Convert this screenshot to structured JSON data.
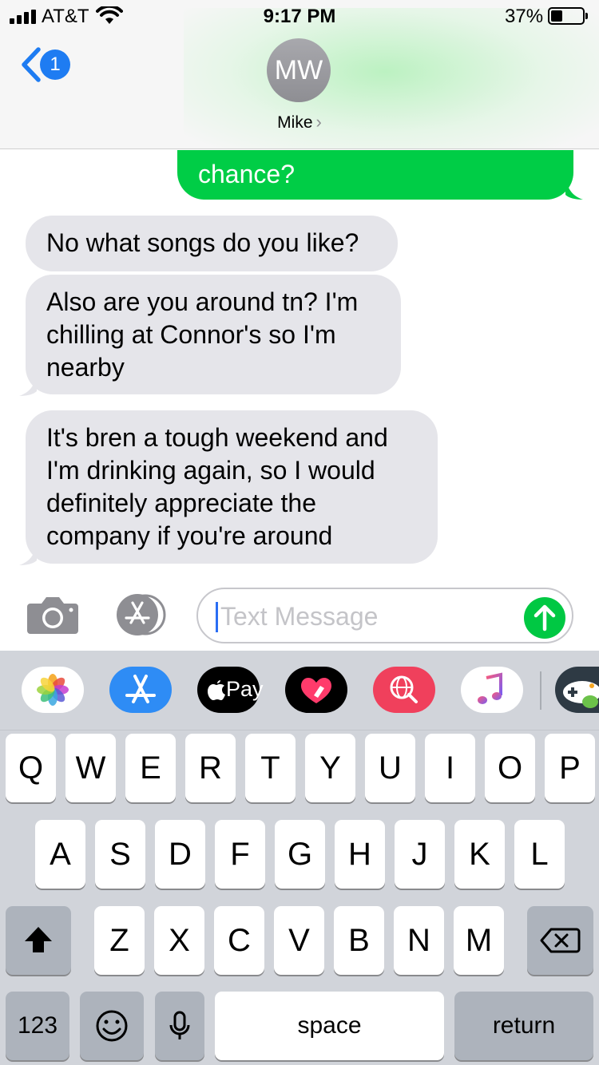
{
  "status_bar": {
    "carrier": "AT&T",
    "time": "9:17 PM",
    "battery_percent": "37%",
    "battery_level": 0.37
  },
  "header": {
    "back_badge": "1",
    "avatar_initials": "MW",
    "contact_name": "Mike",
    "contact_chevron": "›"
  },
  "messages": [
    {
      "from": "me",
      "text": "chance?"
    },
    {
      "from": "them",
      "text": "No what songs do you like?"
    },
    {
      "from": "them",
      "lines": [
        "Also are you around tn? I'm",
        "chilling at Connor's so I'm",
        "nearby"
      ]
    },
    {
      "from": "them",
      "lines": [
        "It's bren a tough weekend and",
        "I'm drinking again, so I would",
        "definitely appreciate the",
        "company if you're around"
      ]
    }
  ],
  "input": {
    "placeholder": "Text Message"
  },
  "app_strip": [
    {
      "name": "photos-icon",
      "bg": "#ffffff"
    },
    {
      "name": "app-store-icon",
      "bg": "#2e8cf5"
    },
    {
      "name": "apple-pay-icon",
      "bg": "#000000",
      "label": "Pay"
    },
    {
      "name": "digital-touch-icon",
      "bg": "#000000"
    },
    {
      "name": "images-search-icon",
      "bg": "#f0405c"
    },
    {
      "name": "music-icon",
      "bg": "#ffffff"
    },
    {
      "name": "game-app-icon",
      "bg": "#2e3a44"
    }
  ],
  "keyboard": {
    "row1": [
      "Q",
      "W",
      "E",
      "R",
      "T",
      "Y",
      "U",
      "I",
      "O",
      "P"
    ],
    "row2": [
      "A",
      "S",
      "D",
      "F",
      "G",
      "H",
      "J",
      "K",
      "L"
    ],
    "row3": [
      "Z",
      "X",
      "C",
      "V",
      "B",
      "N",
      "M"
    ],
    "numbers_key": "123",
    "space_key": "space",
    "return_key": "return"
  },
  "colors": {
    "sent_bubble": "#00cd46",
    "received_bubble": "#e5e5ea",
    "accent_blue": "#1e7cf2",
    "send_button": "#00c843"
  }
}
